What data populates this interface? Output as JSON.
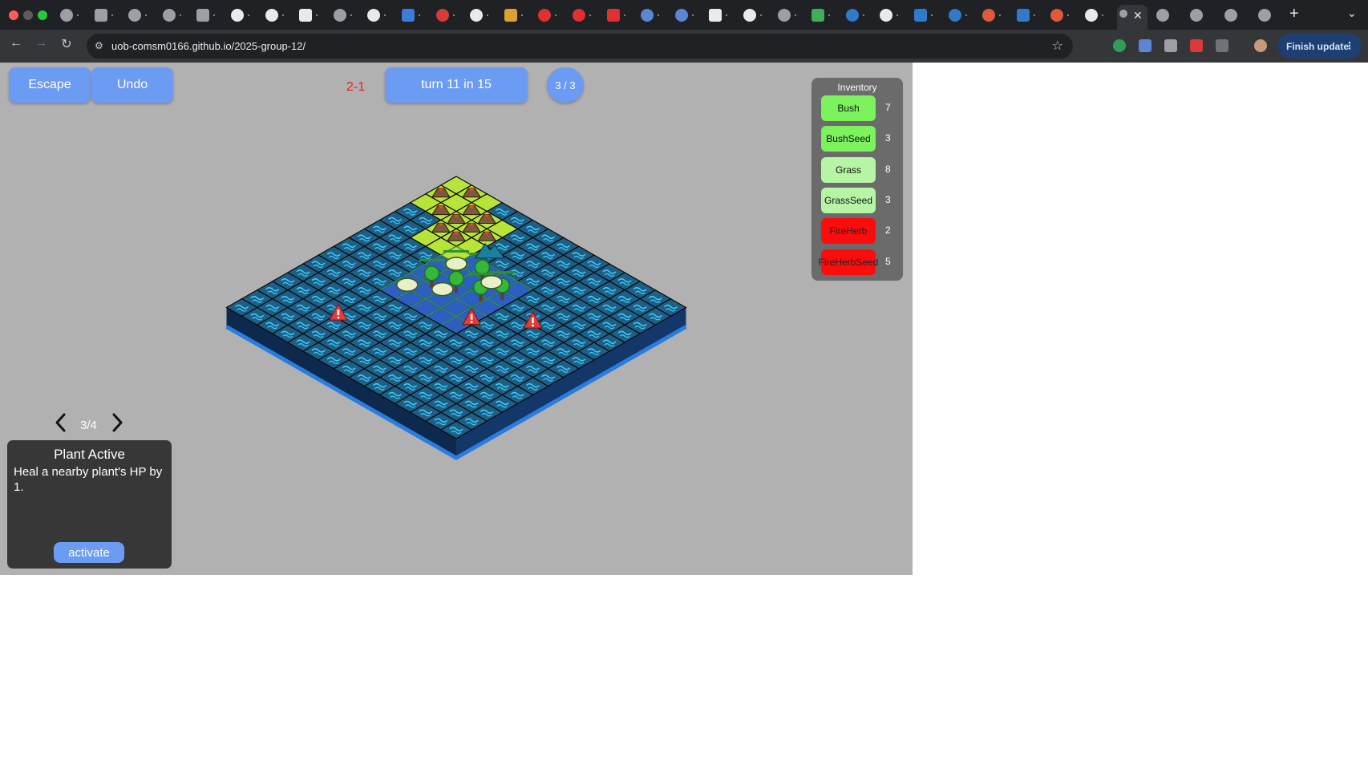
{
  "browser": {
    "url": "uob-comsm0166.github.io/2025-group-12/",
    "finish_update_label": "Finish update",
    "new_tab_symbol": "+",
    "close_tab_symbol": "✕"
  },
  "game": {
    "escape_label": "Escape",
    "undo_label": "Undo",
    "level_label": "2-1",
    "turn_label": "turn 11 in 15",
    "counter_label": "3 / 3",
    "inventory": {
      "title": "Inventory",
      "items": [
        {
          "name": "Bush",
          "count": "7",
          "color": "#7cf25d",
          "text_color": "#111111"
        },
        {
          "name": "BushSeed",
          "count": "3",
          "color": "#7cf25d",
          "text_color": "#111111"
        },
        {
          "name": "Grass",
          "count": "8",
          "color": "#b6f5a4",
          "text_color": "#111111"
        },
        {
          "name": "GrassSeed",
          "count": "3",
          "color": "#b6f5a4",
          "text_color": "#111111"
        },
        {
          "name": "FireHerb",
          "count": "2",
          "color": "#fc0d0d",
          "text_color": "#222222"
        },
        {
          "name": "FireHerbSeed",
          "count": "5",
          "color": "#fc0d0d",
          "text_color": "#222222"
        }
      ]
    },
    "card_pager_label": "3/4",
    "card": {
      "title": "Plant Active",
      "description": "Heal a nearby plant's HP by 1.",
      "action_label": "activate"
    }
  },
  "colors": {
    "button_blue": "#6b9bf3",
    "game_background": "#b1b1b1",
    "water_tile": "#1f5f86",
    "grass_tile": "#b8e43a",
    "soil": "#c8733a",
    "enemy_marker": "#e63a3a"
  },
  "icons": [
    "back-arrow-icon",
    "forward-arrow-icon",
    "reload-icon",
    "site-info-icon",
    "star-icon",
    "chevron-left-icon",
    "chevron-right-icon",
    "warning-icon",
    "volcano-icon",
    "tree-icon",
    "bush-icon"
  ]
}
